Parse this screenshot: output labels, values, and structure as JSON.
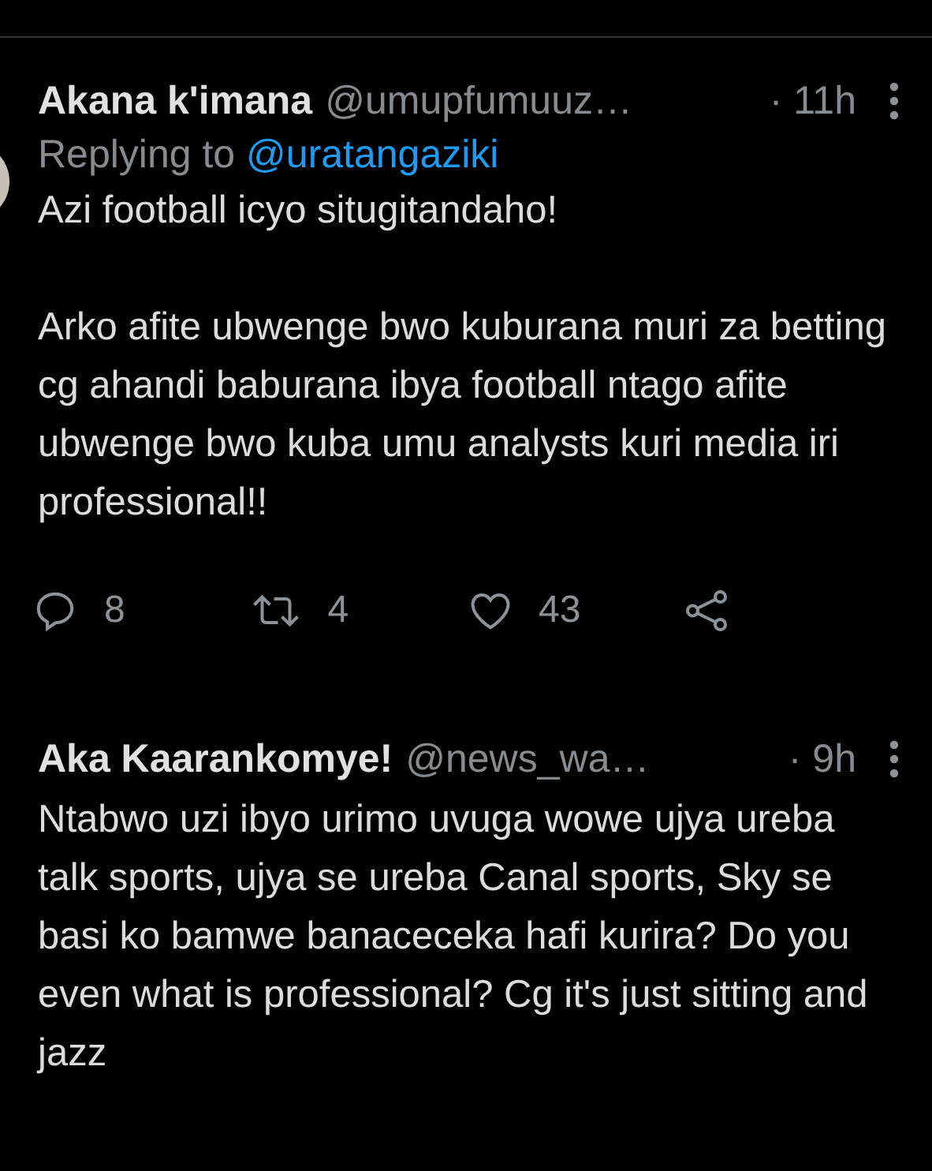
{
  "tweets": [
    {
      "name": "Akana k'imana",
      "handle": "@umupfumuuz…",
      "time": "· 11h",
      "replying_label": "Replying to",
      "replying_to": "@uratangaziki",
      "paragraphs": [
        "Azi football icyo situgitandaho!",
        "Arko afite ubwenge bwo kuburana muri za betting cg ahandi baburana ibya football ntago afite ubwenge bwo kuba umu analysts kuri media iri professional!!"
      ],
      "actions": [
        {
          "kind": "reply",
          "count": "8"
        },
        {
          "kind": "retweet",
          "count": "4"
        },
        {
          "kind": "like",
          "count": "43"
        },
        {
          "kind": "share"
        }
      ]
    },
    {
      "name": "Aka Kaarankomye!",
      "handle": "@news_wa…",
      "time": "· 9h",
      "paragraphs": [
        "Ntabwo uzi ibyo urimo uvuga wowe ujya ureba talk sports, ujya se ureba Canal sports, Sky se basi ko bamwe banaceceka hafi kurira? Do you even what is professional? Cg it's just sitting and jazz"
      ]
    }
  ]
}
